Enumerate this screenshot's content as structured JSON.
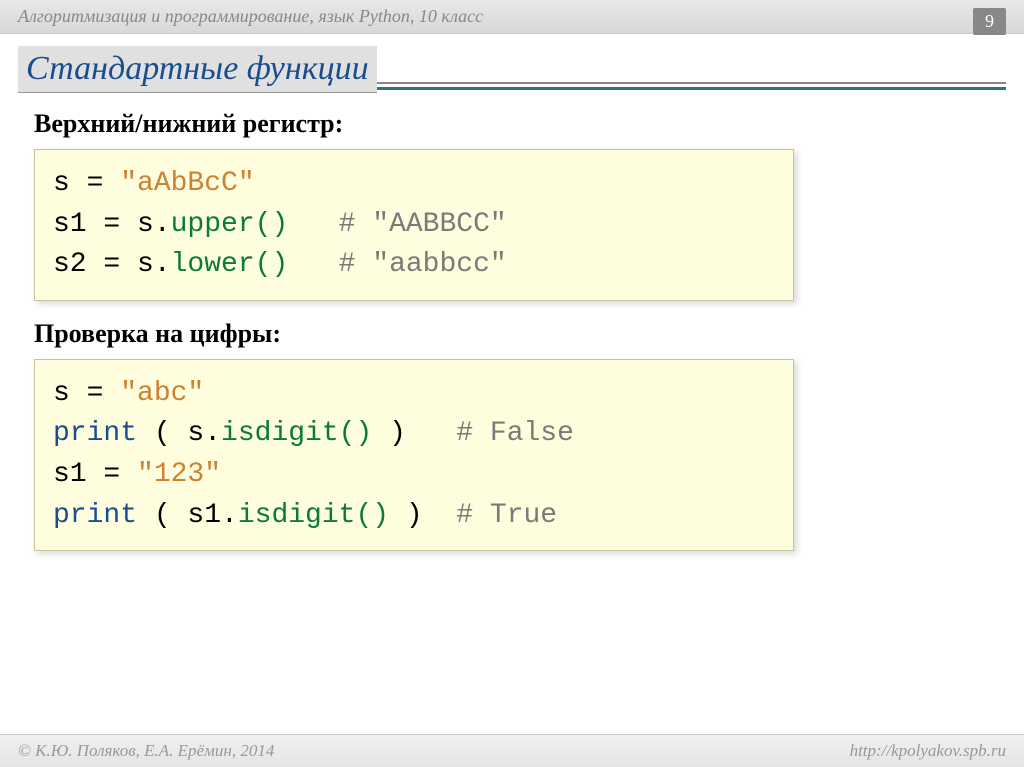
{
  "header": {
    "course": "Алгоритмизация и программирование, язык Python, 10 класс",
    "page_number": "9"
  },
  "title": "Стандартные функции",
  "section1": {
    "heading": "Верхний/нижний регистр:",
    "code": {
      "l1_pre": "s = ",
      "l1_str": "\"aAbBcC\"",
      "l2_pre": "s1 = s.",
      "l2_method": "upper()",
      "l2_gap": "   ",
      "l2_comment": "# \"AABBCC\"",
      "l3_pre": "s2 = s.",
      "l3_method": "lower()",
      "l3_gap": "   ",
      "l3_comment": "# \"aabbcc\""
    }
  },
  "section2": {
    "heading": "Проверка на цифры:",
    "code": {
      "l1_pre": "s = ",
      "l1_str": "\"abc\"",
      "l2_print": "print",
      "l2_open": " ( s.",
      "l2_method": "isdigit()",
      "l2_close": " )   ",
      "l2_comment": "# False",
      "l3_pre": "s1 = ",
      "l3_str": "\"123\"",
      "l4_print": "print",
      "l4_open": " ( s1.",
      "l4_method": "isdigit()",
      "l4_close": " )  ",
      "l4_comment": "# True"
    }
  },
  "footer": {
    "left": "© К.Ю. Поляков, Е.А. Ерёмин, 2014",
    "right": "http://kpolyakov.spb.ru"
  }
}
